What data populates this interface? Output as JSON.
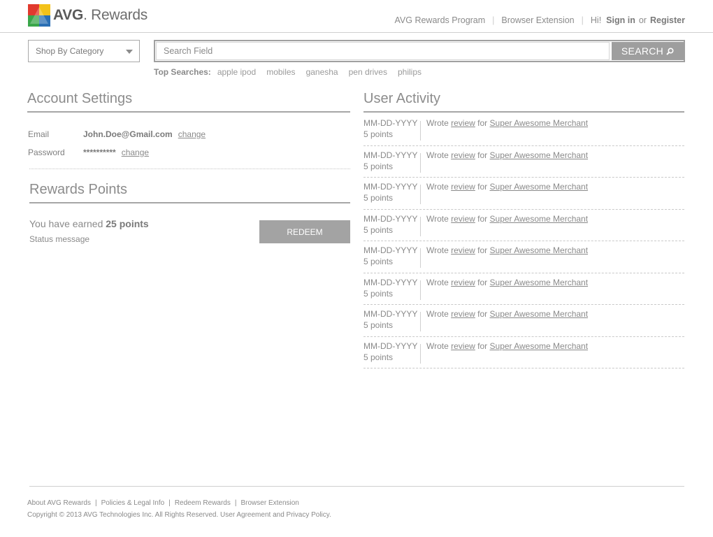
{
  "header": {
    "brand_prefix": "AVG",
    "brand_name": "Rewards",
    "nav": {
      "program": "AVG Rewards Program",
      "extension": "Browser Extension",
      "greeting": "Hi!",
      "sign_in": "Sign in",
      "or": "or",
      "register": "Register"
    }
  },
  "search": {
    "category_label": "Shop By Category",
    "placeholder": "Search Field",
    "button_label": "SEARCH",
    "top_label": "Top Searches:",
    "top_terms": [
      "apple ipod",
      "mobiles",
      "ganesha",
      "pen drives",
      "philips"
    ]
  },
  "account": {
    "title": "Account Settings",
    "email_label": "Email",
    "email_value": "John.Doe@Gmail.com",
    "password_label": "Password",
    "password_value": "**********",
    "change_label": "change"
  },
  "rewards": {
    "title": "Rewards Points",
    "earned_prefix": "You have earned",
    "earned_points": "25 points",
    "status": "Status message",
    "redeem_label": "REDEEM"
  },
  "activity": {
    "title": "User Activity",
    "rows": [
      {
        "date": "MM-DD-YYYY",
        "points": "5 points",
        "wrote": "Wrote",
        "review": "review",
        "for": "for",
        "merchant": "Super Awesome Merchant"
      },
      {
        "date": "MM-DD-YYYY",
        "points": "5 points",
        "wrote": "Wrote",
        "review": "review",
        "for": "for",
        "merchant": "Super Awesome Merchant"
      },
      {
        "date": "MM-DD-YYYY",
        "points": "5 points",
        "wrote": "Wrote",
        "review": "review",
        "for": "for",
        "merchant": "Super Awesome Merchant"
      },
      {
        "date": "MM-DD-YYYY",
        "points": "5 points",
        "wrote": "Wrote",
        "review": "review",
        "for": "for",
        "merchant": "Super Awesome Merchant"
      },
      {
        "date": "MM-DD-YYYY",
        "points": "5 points",
        "wrote": "Wrote",
        "review": "review",
        "for": "for",
        "merchant": "Super Awesome Merchant"
      },
      {
        "date": "MM-DD-YYYY",
        "points": "5 points",
        "wrote": "Wrote",
        "review": "review",
        "for": "for",
        "merchant": "Super Awesome Merchant"
      },
      {
        "date": "MM-DD-YYYY",
        "points": "5 points",
        "wrote": "Wrote",
        "review": "review",
        "for": "for",
        "merchant": "Super Awesome Merchant"
      },
      {
        "date": "MM-DD-YYYY",
        "points": "5 points",
        "wrote": "Wrote",
        "review": "review",
        "for": "for",
        "merchant": "Super Awesome Merchant"
      }
    ]
  },
  "footer": {
    "links": [
      "About AVG Rewards",
      "Policies & Legal Info",
      "Redeem Rewards",
      "Browser Extension"
    ],
    "separator": "|",
    "copyright": "Copyright © 2013 AVG Technologies Inc. All Rights Reserved. User Agreement and Privacy Policy."
  },
  "colors": {
    "logo_green": "#3aa64a",
    "logo_red": "#e13a2e",
    "logo_blue": "#2a6fb5",
    "logo_yellow": "#f3c21a",
    "button_gray": "#a3a3a3"
  },
  "icons": {
    "search": "magnifier-icon",
    "caret": "chevron-down-icon",
    "logo": "avg-logo-icon"
  }
}
